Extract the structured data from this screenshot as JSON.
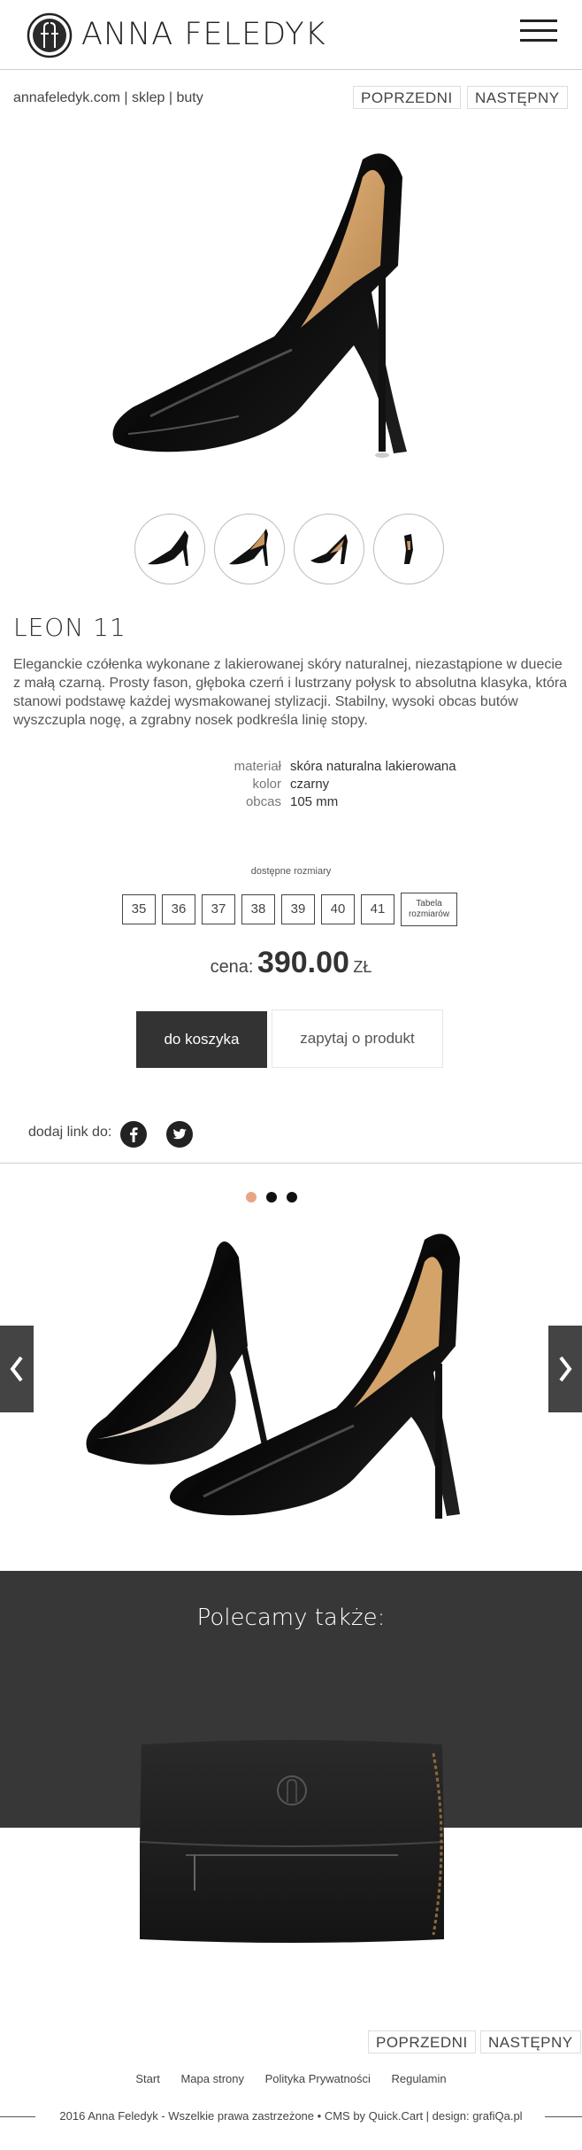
{
  "header": {
    "brand": "ANNA FELEDYK",
    "logo_icon": "af-monogram-logo",
    "menu_icon": "hamburger-menu-icon"
  },
  "breadcrumb": {
    "items": [
      "annafeledyk.com",
      "sklep",
      "buty"
    ],
    "separator": "|"
  },
  "nav": {
    "prev": "POPRZEDNI",
    "next": "NASTĘPNY"
  },
  "product": {
    "name": "LEON 11",
    "description": "Eleganckie czółenka wykonane z lakierowanej skóry naturalnej, niezastąpione w duecie z małą czarną. Prosty fason, głęboka czerń i lustrzany połysk to absolutna klasyka, która stanowi podstawę każdej wysmakowanej stylizacji. Stabilny, wysoki obcas butów wyszczupla nogę, a zgrabny nosek podkreśla linię stopy.",
    "specs": [
      {
        "label": "materiał",
        "value": "skóra naturalna lakierowana"
      },
      {
        "label": "kolor",
        "value": "czarny"
      },
      {
        "label": "obcas",
        "value": "105 mm"
      }
    ],
    "sizes_label": "dostępne rozmiary",
    "sizes": [
      "35",
      "36",
      "37",
      "38",
      "39",
      "40",
      "41"
    ],
    "size_table": "Tabela rozmiarów",
    "price_label": "cena:",
    "price_value": "390.00",
    "currency": "ZŁ",
    "cart_button": "do koszyka",
    "ask_button": "zapytaj o produkt"
  },
  "share": {
    "label": "dodaj link do:",
    "icons": [
      "facebook-icon",
      "twitter-icon"
    ]
  },
  "gallery": {
    "active_dot": 0,
    "dot_count": 3,
    "accent_color": "#e8a585",
    "prev_icon": "chevron-left-icon",
    "next_icon": "chevron-right-icon"
  },
  "recommend": {
    "title": "Polecamy także:"
  },
  "footer": {
    "prev": "POPRZEDNI",
    "next": "NASTĘPNY",
    "links": [
      "Start",
      "Mapa strony",
      "Polityka Prywatności",
      "Regulamin"
    ],
    "copyright": "2016 Anna Feledyk - Wszelkie prawa zastrzeżone",
    "bullet": "•",
    "cms": "CMS by Quick.Cart | design: grafiQa.pl"
  }
}
